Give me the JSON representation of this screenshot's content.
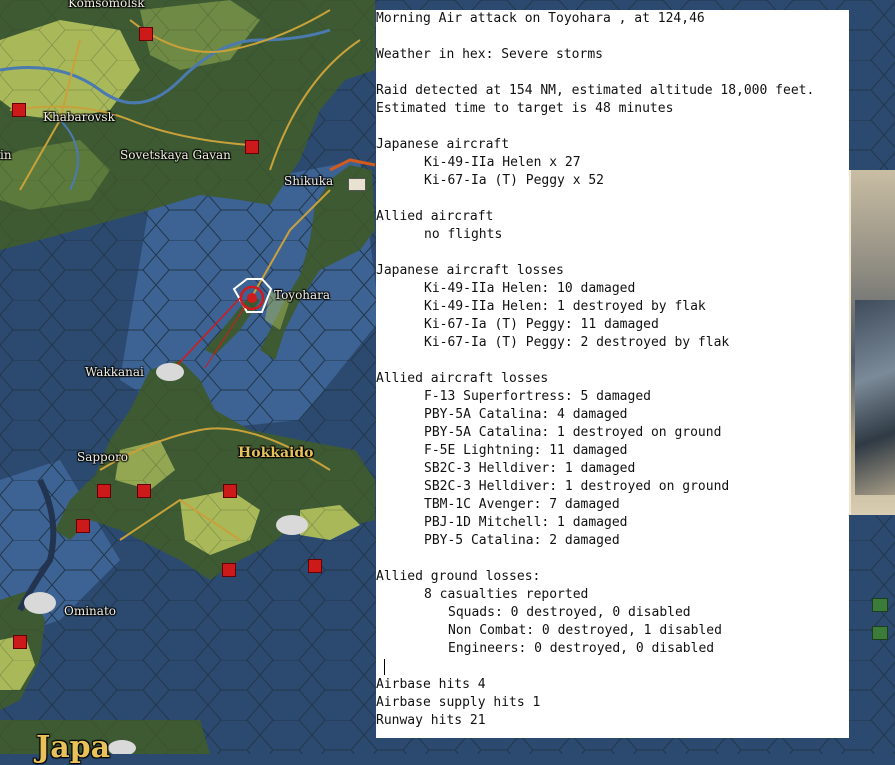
{
  "map": {
    "labels": {
      "komsomolsk": "Komsomolsk",
      "khabarovsk": "Khabarovsk",
      "sovetskaya_gavan": "Sovetskaya Gavan",
      "shikuka": "Shikuka",
      "toyohara": "Toyohara",
      "wakkanai": "Wakkanai",
      "sapporo": "Sapporo",
      "hokkaido": "Hokkaido",
      "ominato": "Ominato",
      "partial_in": "in",
      "partial_japan": "Japa"
    }
  },
  "report": {
    "title": "Morning Air attack on Toyohara , at 124,46",
    "weather": "Weather in hex: Severe storms",
    "raid_line1": "Raid detected at 154 NM, estimated altitude 18,000 feet.",
    "raid_line2": "Estimated time to target is 48 minutes",
    "japanese_aircraft_header": "Japanese aircraft",
    "japanese_aircraft": [
      "Ki-49-IIa Helen x 27",
      "Ki-67-Ia (T) Peggy x 52"
    ],
    "allied_aircraft_header": "Allied aircraft",
    "allied_aircraft": [
      "no flights"
    ],
    "japanese_losses_header": "Japanese aircraft losses",
    "japanese_losses": [
      "Ki-49-IIa Helen: 10 damaged",
      "Ki-49-IIa Helen: 1 destroyed by flak",
      "Ki-67-Ia (T) Peggy: 11 damaged",
      "Ki-67-Ia (T) Peggy: 2 destroyed by flak"
    ],
    "allied_losses_header": "Allied aircraft losses",
    "allied_losses": [
      "F-13 Superfortress: 5 damaged",
      "PBY-5A Catalina: 4 damaged",
      "PBY-5A Catalina: 1 destroyed on ground",
      "F-5E Lightning: 11 damaged",
      "SB2C-3 Helldiver: 1 damaged",
      "SB2C-3 Helldiver: 1 destroyed on ground",
      "TBM-1C Avenger: 7 damaged",
      "PBJ-1D Mitchell: 1 damaged",
      "PBY-5 Catalina: 2 damaged"
    ],
    "ground_losses_header": "Allied ground losses:",
    "casualties": "8 casualties reported",
    "ground_details": [
      "Squads: 0 destroyed, 0 disabled",
      "Non Combat: 0 destroyed, 1 disabled",
      "Engineers: 0 destroyed, 0 disabled"
    ],
    "airbase_hits": "Airbase hits 4",
    "airbase_supply_hits": "Airbase supply hits 1",
    "runway_hits": "Runway hits 21"
  },
  "colors": {
    "deep_sea": "#2c4a70",
    "shallow_sea": "#3d6394",
    "land_forest": "#3d5a33",
    "land_plain": "#a9b95a",
    "road": "#c9a13a",
    "border": "#d25a1c"
  }
}
